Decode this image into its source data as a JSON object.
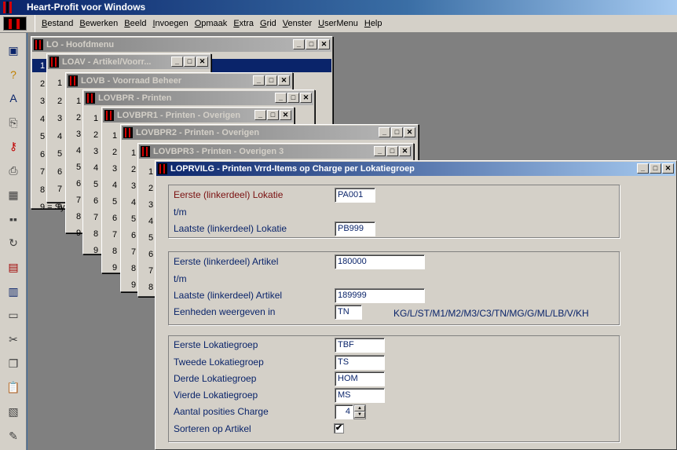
{
  "app": {
    "title": "Heart-Profit voor Windows"
  },
  "menu": [
    "Bestand",
    "Bewerken",
    "Beeld",
    "Invoegen",
    "Opmaak",
    "Extra",
    "Grid",
    "Venster",
    "UserMenu",
    "Help"
  ],
  "toolbar_icons": [
    "screen-icon",
    "help-icon",
    "font-icon",
    "import-icon",
    "key-icon",
    "print-icon",
    "calculator-icon",
    "dots-icon",
    "refresh-icon",
    "report-icon",
    "chart-icon",
    "window-icon",
    "cut-icon",
    "copy-icon",
    "paste-icon",
    "paste-special-icon",
    "edit-icon"
  ],
  "windows": {
    "w1": {
      "title": "LO - Hoofdmenu",
      "nums": [
        "1",
        "2",
        "3",
        "4",
        "5",
        "6",
        "7",
        "8",
        "9 = Sy"
      ]
    },
    "w2": {
      "title": "LOAV - Artikel/Voorr...",
      "nums": [
        "1",
        "2",
        "3",
        "4",
        "5",
        "6",
        "7",
        "8"
      ]
    },
    "w3": {
      "title": "LOVB - Voorraad Beheer",
      "nums": [
        "1",
        "2",
        "3",
        "4",
        "5",
        "6",
        "7",
        "8",
        "9"
      ]
    },
    "w4": {
      "title": "LOVBPR - Printen",
      "nums": [
        "1",
        "2",
        "3",
        "4",
        "5",
        "6",
        "7",
        "8",
        "9"
      ]
    },
    "w5": {
      "title": "LOVBPR1 - Printen - Overigen",
      "nums": [
        "1",
        "2",
        "3",
        "4",
        "5",
        "6",
        "7",
        "8",
        "9"
      ]
    },
    "w6": {
      "title": "LOVBPR2 - Printen - Overigen",
      "nums": [
        "1",
        "2",
        "3",
        "4",
        "5",
        "6",
        "7",
        "8",
        "9"
      ]
    },
    "w7": {
      "title": "LOVBPR3 - Printen - Overigen 3",
      "nums": [
        "1",
        "2",
        "3",
        "4",
        "5",
        "6",
        "7",
        "8"
      ]
    }
  },
  "main": {
    "title": "LOPRVILG - Printen Vrrd-Items op Charge per Lokatiegroep",
    "loc": {
      "from_label": "Eerste  (linkerdeel) Lokatie",
      "from_value": "PA001",
      "tm": "t/m",
      "to_label": "Laatste (linkerdeel) Lokatie",
      "to_value": "PB999"
    },
    "art": {
      "from_label": "Eerste  (linkerdeel) Artikel",
      "from_value": "180000",
      "tm": "t/m",
      "to_label": "Laatste (linkerdeel) Artikel",
      "to_value": "189999",
      "units_label": "Eenheden weergeven in",
      "units_value": "TN",
      "units_hint": "KG/L/ST/M1/M2/M3/C3/TN/MG/G/ML/LB/V/KH"
    },
    "grp": {
      "g1_label": "Eerste Lokatiegroep",
      "g1_value": "TBF",
      "g2_label": "Tweede Lokatiegroep",
      "g2_value": "TS",
      "g3_label": "Derde Lokatiegroep",
      "g3_value": "HOM",
      "g4_label": "Vierde Lokatiegroep",
      "g4_value": "MS",
      "charge_label": "Aantal posities Charge",
      "charge_value": "4",
      "sort_label": "Sorteren op Artikel",
      "sort_checked": "✔"
    }
  }
}
